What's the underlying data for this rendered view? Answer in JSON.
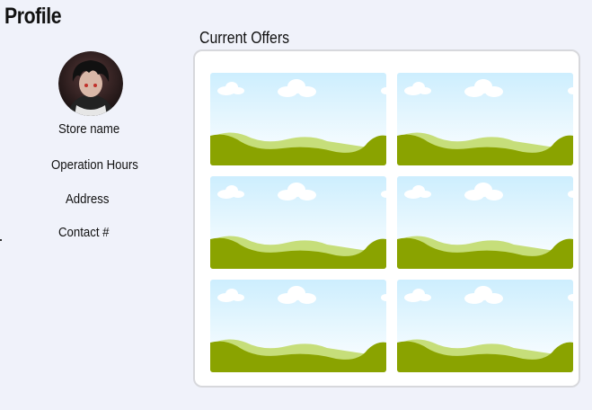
{
  "page": {
    "title": "Profile"
  },
  "profile": {
    "avatar_icon": "anime-character-avatar",
    "store_name": "Store name",
    "operation_hours": "Operation Hours",
    "address": "Address",
    "contact": "Contact #"
  },
  "offers": {
    "label": "Current Offers",
    "items": [
      {
        "image": "landscape-placeholder-image"
      },
      {
        "image": "landscape-placeholder-image"
      },
      {
        "image": "landscape-placeholder-image"
      },
      {
        "image": "landscape-placeholder-image"
      },
      {
        "image": "landscape-placeholder-image"
      },
      {
        "image": "landscape-placeholder-image"
      }
    ]
  },
  "colors": {
    "background": "#f0f2fa",
    "panel_border": "#d7d8dc",
    "sky": "#cdeefe",
    "hill_dark": "#8aa300",
    "hill_light": "#c6de7a"
  }
}
